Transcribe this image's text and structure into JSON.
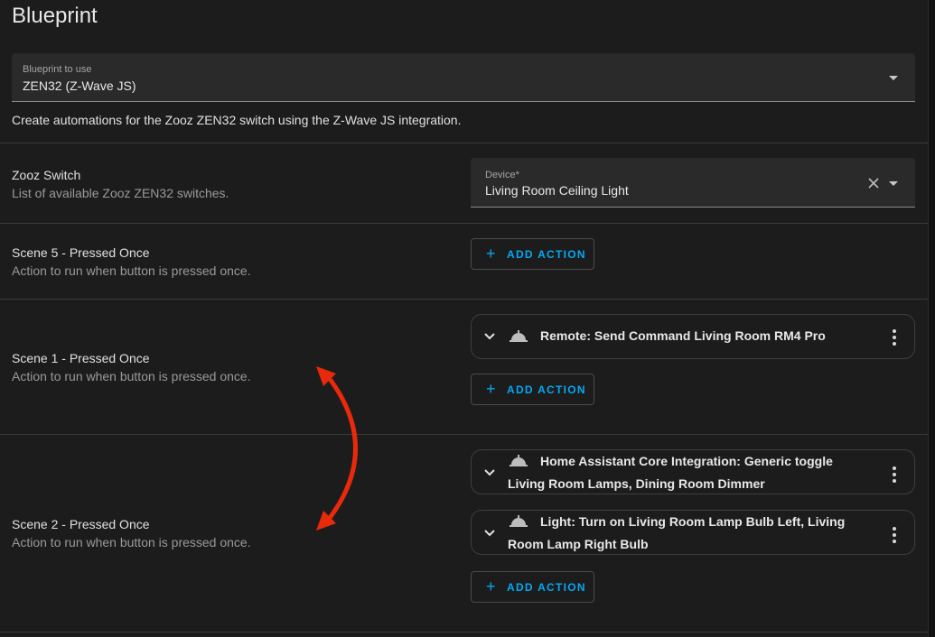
{
  "page": {
    "title": "Blueprint"
  },
  "blueprint_select": {
    "label": "Blueprint to use",
    "value": "ZEN32 (Z-Wave JS)"
  },
  "description": "Create automations for the Zooz ZEN32 switch using the Z-Wave JS integration.",
  "zooz_switch": {
    "title": "Zooz Switch",
    "subtitle": "List of available Zooz ZEN32 switches.",
    "device_label": "Device*",
    "device_value": "Living Room Ceiling Light"
  },
  "scene5": {
    "title": "Scene 5 - Pressed Once",
    "subtitle": "Action to run when button is pressed once.",
    "add_action": "ADD ACTION"
  },
  "scene1": {
    "title": "Scene 1 - Pressed Once",
    "subtitle": "Action to run when button is pressed once.",
    "actions": [
      {
        "text": "Remote: Send Command Living Room RM4 Pro"
      }
    ],
    "add_action": "ADD ACTION"
  },
  "scene2": {
    "title": "Scene 2 - Pressed Once",
    "subtitle": "Action to run when button is pressed once.",
    "actions": [
      {
        "text": "Home Assistant Core Integration: Generic toggle Living Room Lamps, Dining Room Dimmer"
      },
      {
        "text": "Light: Turn on Living Room Lamp Bulb Left, Living Room Lamp Right Bulb"
      }
    ],
    "add_action": "ADD ACTION"
  },
  "icons": {
    "action": "service-bell-icon",
    "expand": "chevron-down-icon",
    "menu": "dots-vertical-icon",
    "clear": "close-icon",
    "dropdown": "menu-down-icon",
    "annotation": "double-headed-curved-arrow"
  },
  "colors": {
    "accent": "#03a9f4",
    "annotation": "#e8290c",
    "background": "#1c1c1c"
  }
}
